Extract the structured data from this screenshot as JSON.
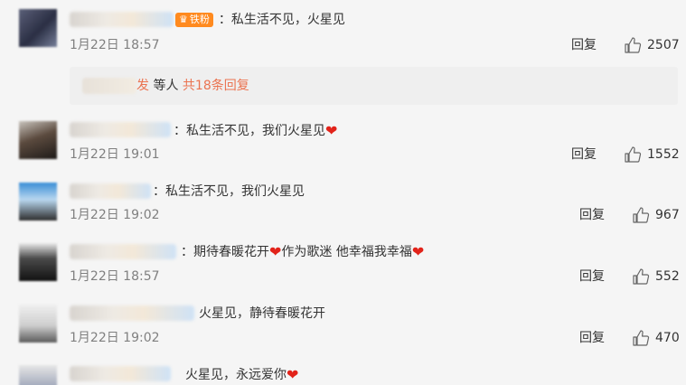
{
  "colors": {
    "background": "#f5f5f5",
    "accent": "#eb7350",
    "muted": "#808080",
    "heart": "#e2231a"
  },
  "comments": [
    {
      "text": "：私生活不见，火星见",
      "badge": "铁粉",
      "time": "1月22日 18:57",
      "reply": "回复",
      "likes": "2507"
    },
    {
      "text": "：私生活不见，我们火星见",
      "time": "1月22日 19:01",
      "reply": "回复",
      "likes": "1552"
    },
    {
      "text": "：私生活不见，我们火星见",
      "time": "1月22日 19:02",
      "reply": "回复",
      "likes": "967"
    },
    {
      "text_part1": "：期待春暖花开",
      "text_part2": "作为歌迷 他幸福我幸福",
      "time": "1月22日 18:57",
      "reply": "回复",
      "likes": "552"
    },
    {
      "text": "火星见，静待春暖花开",
      "time": "1月22日 19:02",
      "reply": "回复",
      "likes": "470"
    },
    {
      "text": "火星见，永远爱你"
    }
  ],
  "more_replies": {
    "suffix": "发",
    "label": " 等人 ",
    "link": "共18条回复"
  },
  "icons": {
    "like": "thumbs-up-icon",
    "heart": "heart-icon",
    "badge": "crown-icon"
  },
  "glyphs": {
    "heart": "❤"
  }
}
